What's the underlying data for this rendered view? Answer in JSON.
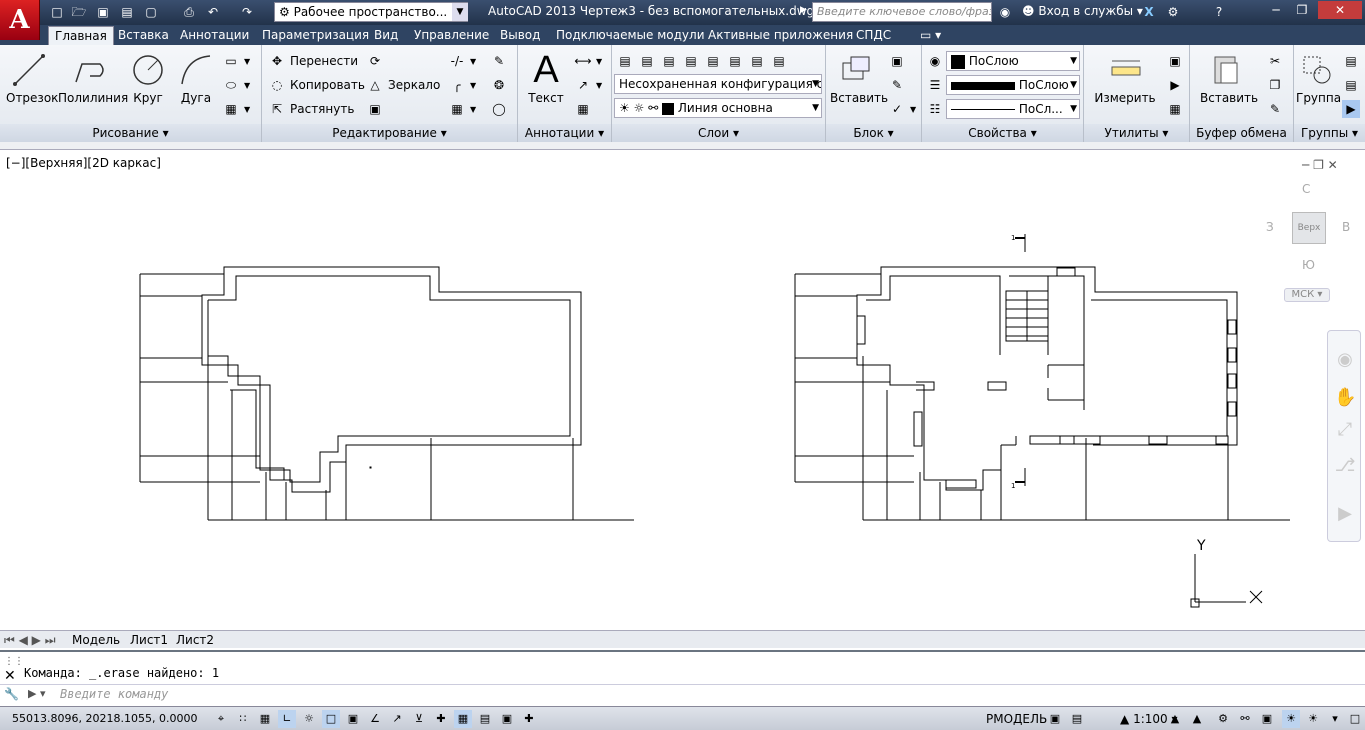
{
  "app": {
    "logo_letter": "A"
  },
  "quick_access": {
    "icons": [
      "new-icon",
      "open-icon",
      "save-icon",
      "save-as-icon",
      "plot-preview-icon",
      "print-icon",
      "undo-icon",
      "redo-icon"
    ],
    "workspace": "Рабочее пространство..."
  },
  "title": "AutoCAD 2013    Чертеж3 - без вспомогательных.dwg",
  "search": {
    "placeholder": "Введите ключевое слово/фразу"
  },
  "signin": "Вход в службы",
  "ribbon_tabs": [
    "Главная",
    "Вставка",
    "Аннотации",
    "Параметризация",
    "Вид",
    "Управление",
    "Вывод",
    "Подключаемые модули",
    "Активные приложения",
    "СПДС"
  ],
  "draw_panel": {
    "title": "Рисование",
    "line": "Отрезок",
    "polyline": "Полилиния",
    "circle": "Круг",
    "arc": "Дуга"
  },
  "modify_panel": {
    "title": "Редактирование",
    "move": "Перенести",
    "copy": "Копировать",
    "stretch": "Растянуть",
    "mirror": "Зеркало"
  },
  "annotation_panel": {
    "title": "Аннотации",
    "text": "Текст"
  },
  "layers_panel": {
    "title": "Слои",
    "layer_state": "Несохраненная конфигурация слоя",
    "current_layer": "Линия основна"
  },
  "block_panel": {
    "title": "Блок",
    "insert": "Вставить"
  },
  "properties_panel": {
    "title": "Свойства",
    "color": "ПоСлою",
    "lineweight": "ПоСлою",
    "linetype": "ПоСл..."
  },
  "utilities_panel": {
    "title": "Утилиты",
    "measure": "Измерить"
  },
  "clipboard_panel": {
    "title": "Буфер обмена",
    "paste": "Вставить"
  },
  "groups_panel": {
    "title": "Группы",
    "group": "Группа"
  },
  "viewport": {
    "label": "[−][Верхняя][2D каркас]",
    "viewcube": {
      "north": "С",
      "south": "Ю",
      "west": "З",
      "east": "В",
      "face": "Верх",
      "ucs": "МСК"
    },
    "ucs_y": "Y",
    "section_mark": "1"
  },
  "layout_tabs": [
    "Модель",
    "Лист1",
    "Лист2"
  ],
  "command": {
    "history": "Команда:  _.erase найдено: 1",
    "placeholder": "Введите команду"
  },
  "status": {
    "coords": "55013.8096, 20218.1055, 0.0000",
    "model": "РМОДЕЛЬ",
    "scale": "1:100"
  }
}
